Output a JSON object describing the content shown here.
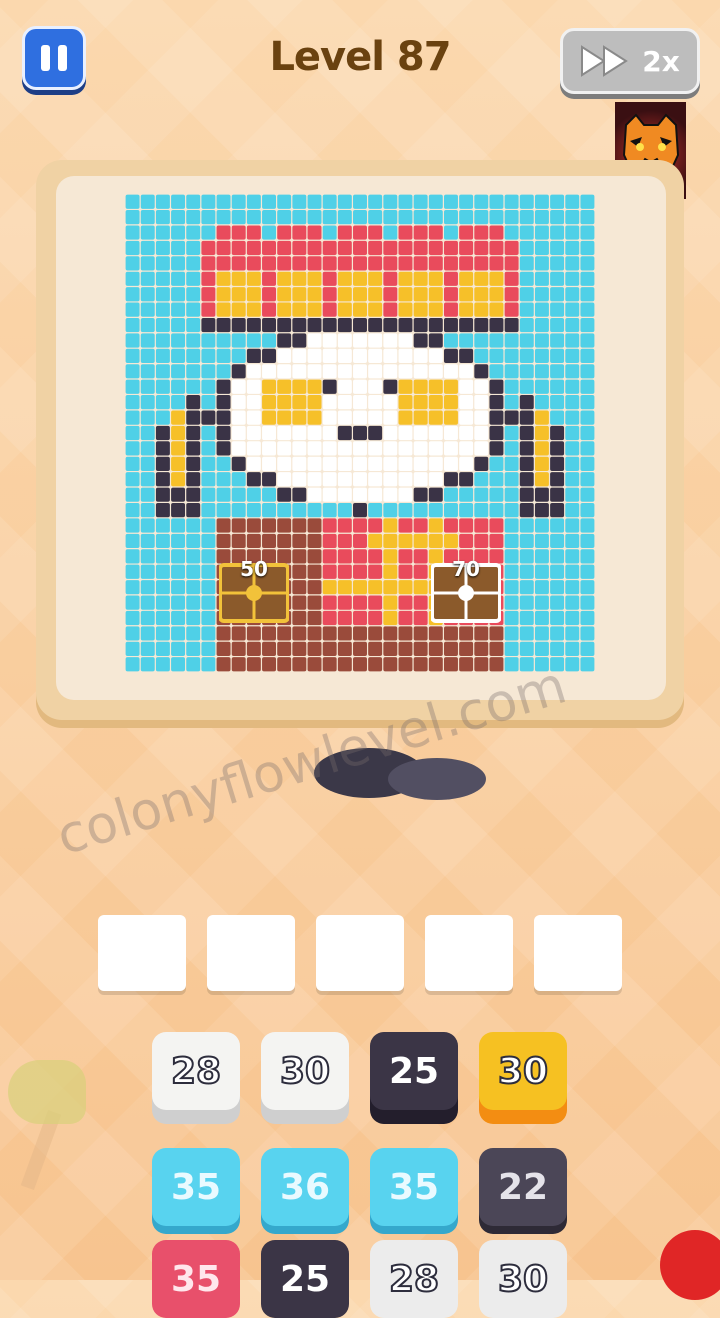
{
  "header": {
    "level_label": "Level 87",
    "speed_label": "2x"
  },
  "icons": {
    "pause": "pause-icon",
    "fast_forward": "fast-forward-icon",
    "tiger": "tiger-avatar-icon",
    "chest": "treasure-chest-icon"
  },
  "colors": {
    "background": "#cyan",
    "sky": "#4fd0e7",
    "crown_red": "#e94b5c",
    "crown_yellow": "#f6c029",
    "face_white": "#ffffff",
    "outline_dark": "#3a3346",
    "robe_brown": "#9a4b3b"
  },
  "puzzle": {
    "chests": [
      {
        "value": "50"
      },
      {
        "value": "70"
      }
    ]
  },
  "watermark": "colonyflowlevel.com",
  "tray": {
    "slots": [
      "",
      "",
      "",
      "",
      ""
    ]
  },
  "blocks": {
    "row1": [
      {
        "value": "28",
        "color": "white"
      },
      {
        "value": "30",
        "color": "white"
      },
      {
        "value": "25",
        "color": "dark"
      },
      {
        "value": "30",
        "color": "yellow"
      }
    ],
    "row2": [
      {
        "value": "35",
        "color": "cyan"
      },
      {
        "value": "36",
        "color": "cyan"
      },
      {
        "value": "35",
        "color": "cyan"
      },
      {
        "value": "22",
        "color": "darkgray"
      }
    ],
    "row3": [
      {
        "value": "35",
        "color": "red"
      },
      {
        "value": "25",
        "color": "dark"
      },
      {
        "value": "28",
        "color": "gray"
      },
      {
        "value": "30",
        "color": "gray"
      }
    ]
  }
}
